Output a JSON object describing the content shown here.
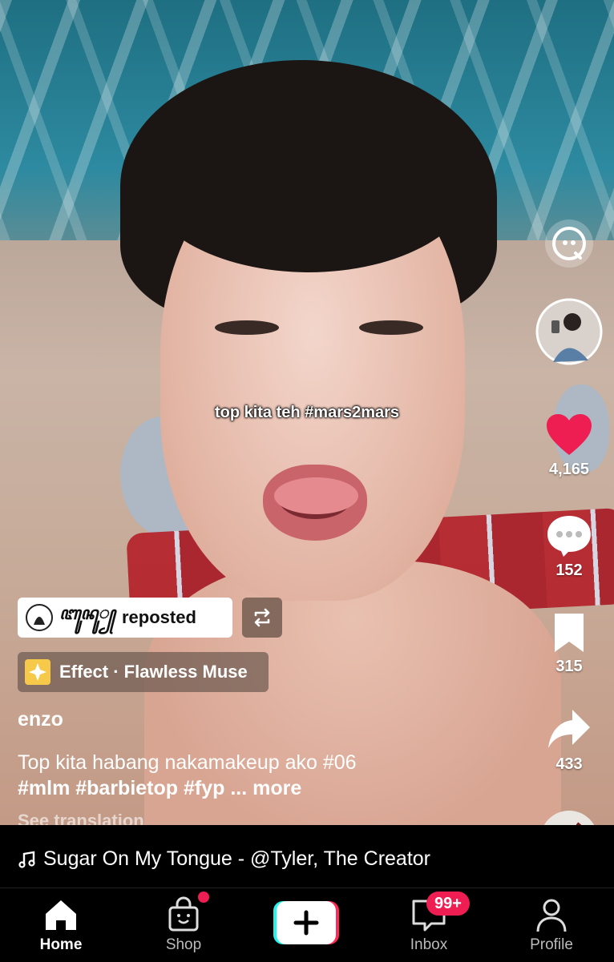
{
  "video": {
    "overlay_caption": "top kita teh #mars2mars"
  },
  "rail": {
    "like_count": "4,165",
    "comment_count": "152",
    "bookmark_count": "315",
    "share_count": "433"
  },
  "repost": {
    "author": "ꦧꦸꦤꦸ꧀",
    "label": "reposted"
  },
  "effect": {
    "label": "Effect · Flawless Muse"
  },
  "post": {
    "username": "enzo",
    "description_line1": "Top kita habang nakamakeup ako #06",
    "description_line2_tags": "#mlm #barbietop #fyp",
    "more_label": "... more",
    "see_translation": "See translation"
  },
  "music": {
    "title": "Sugar On My Tongue - @Tyler, The Creator"
  },
  "nav": {
    "home": "Home",
    "shop": "Shop",
    "inbox": "Inbox",
    "inbox_badge": "99+",
    "profile": "Profile"
  },
  "colors": {
    "like_red": "#ee1d52",
    "badge_red": "#ee1d52",
    "create_cyan": "#25f4ee",
    "create_pink": "#fe2c55"
  }
}
